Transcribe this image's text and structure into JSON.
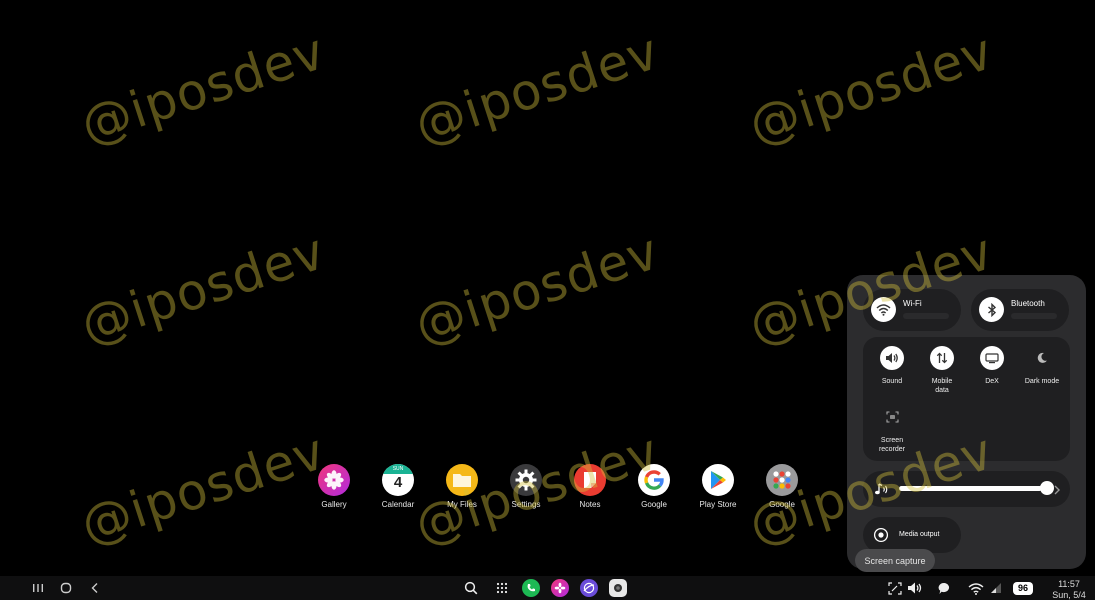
{
  "watermark": "@iposdev",
  "dock": {
    "apps": [
      {
        "label": "Gallery",
        "icon": "gallery-icon"
      },
      {
        "label": "Calendar",
        "icon": "calendar-icon",
        "day_name": "SUN",
        "day_number": "4"
      },
      {
        "label": "My Files",
        "icon": "folder-icon"
      },
      {
        "label": "Settings",
        "icon": "gear-icon"
      },
      {
        "label": "Notes",
        "icon": "notes-icon"
      },
      {
        "label": "Google",
        "icon": "google-icon"
      },
      {
        "label": "Play Store",
        "icon": "play-store-icon"
      },
      {
        "label": "Google",
        "icon": "google-folder-icon"
      }
    ]
  },
  "quick_panel": {
    "wifi_label": "Wi-Fi",
    "bluetooth_label": "Bluetooth",
    "tiles": [
      {
        "label": "Sound",
        "icon": "sound-icon"
      },
      {
        "label": "Mobile data",
        "icon": "mobile-data-icon"
      },
      {
        "label": "DeX",
        "icon": "dex-icon"
      },
      {
        "label": "Dark mode",
        "icon": "moon-icon"
      },
      {
        "label": "Screen recorder",
        "icon": "screen-recorder-icon"
      }
    ],
    "volume_level": 0.93,
    "media_output_label": "Media output"
  },
  "tooltip": "Screen capture",
  "status": {
    "battery": "96",
    "time": "11:57",
    "date": "Sun, 5/4"
  },
  "colors": {
    "panel_bg": "#2c2c2e",
    "tile_bg": "#1f1f21",
    "phone_green": "#1db954",
    "watermark": "#d2be3c"
  }
}
